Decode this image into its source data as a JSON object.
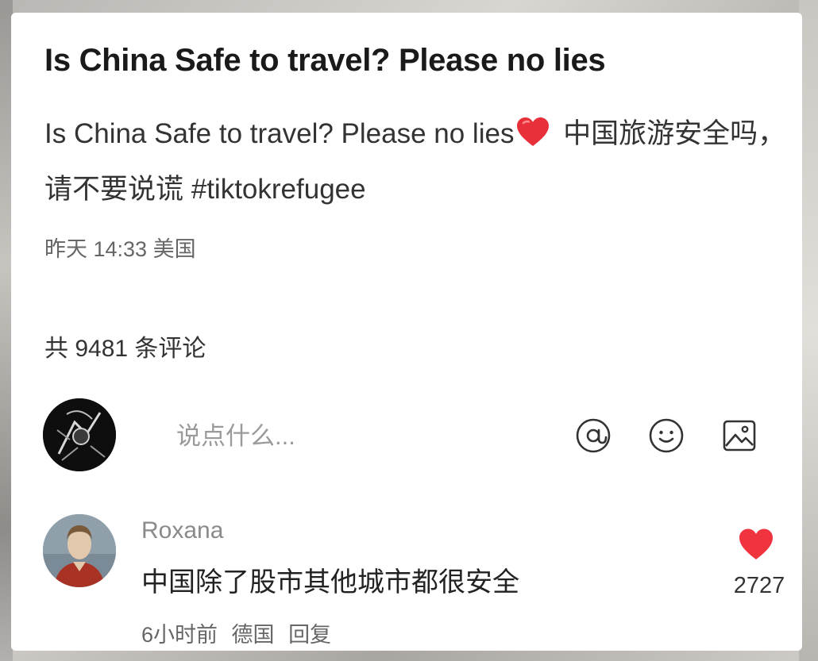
{
  "post": {
    "title": "Is China Safe to travel? Please no lies",
    "body_part1": "Is China Safe to travel? Please no lies",
    "body_part2": " 中国旅游安全吗，请不要说谎 ",
    "hashtag": "#tiktokrefugee",
    "emoji_icon": "red-heart-icon",
    "meta": "昨天 14:33 美国"
  },
  "comments_section": {
    "count_text": "共 9481 条评论",
    "input": {
      "placeholder": "说点什么...",
      "value": ""
    },
    "icons": [
      "at-icon",
      "emoji-smile-icon",
      "image-icon"
    ],
    "comments": [
      {
        "author": "Roxana",
        "text": "中国除了股市其他城市都很安全",
        "time": "6小时前",
        "location": "德国",
        "reply_label": "回复",
        "likes": "2727",
        "liked": true
      }
    ]
  },
  "colors": {
    "heart": "#f0343f",
    "primary_text": "#1a1a1a",
    "secondary_text": "#666666",
    "placeholder": "#9a9a9a"
  }
}
